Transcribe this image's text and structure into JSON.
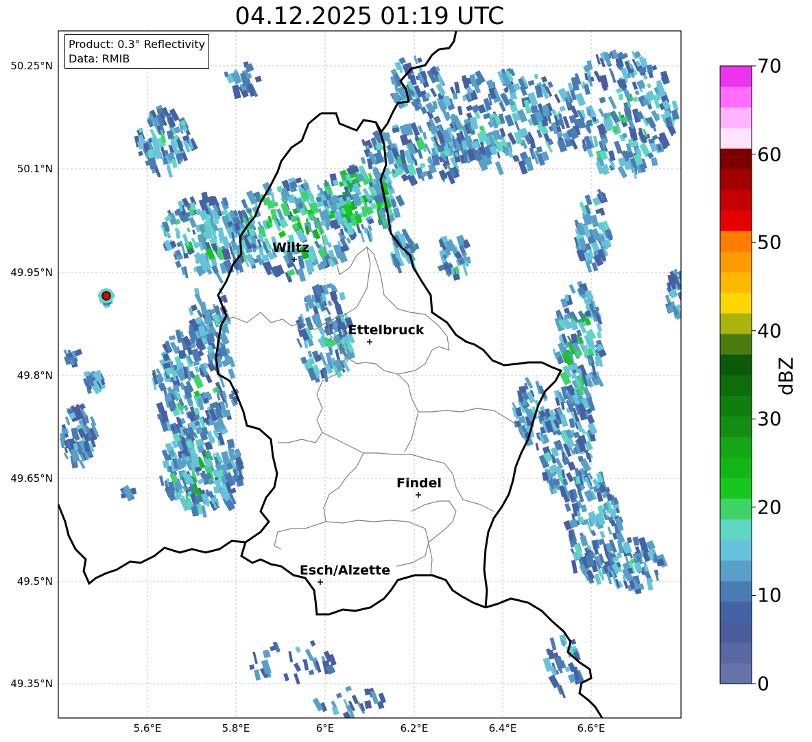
{
  "title": "04.12.2025 01:19 UTC",
  "info": {
    "product": "Product: 0.3° Reflectivity",
    "source": "Data: RMIB"
  },
  "lat_labels": [
    "50.25°N",
    "50.1°N",
    "49.95°N",
    "49.8°N",
    "49.65°N",
    "49.5°N",
    "49.35°N"
  ],
  "lon_labels": [
    "5.6°E",
    "5.8°E",
    "6°E",
    "6.2°E",
    "6.4°E",
    "6.6°E"
  ],
  "cities": [
    {
      "name": "Wiltz"
    },
    {
      "name": "Ettelbruck"
    },
    {
      "name": "Findel"
    },
    {
      "name": "Esch/Alzette"
    }
  ],
  "colorbar": {
    "unit": "dBZ",
    "ticks": [
      "70",
      "60",
      "50",
      "40",
      "30",
      "20",
      "10",
      "0"
    ],
    "min": 0,
    "max": 70,
    "step": 2.5,
    "colors": [
      "#6673a8",
      "#5968a2",
      "#4c5d9e",
      "#4462a6",
      "#4a7cb4",
      "#58a0c8",
      "#67c3db",
      "#5ed7c3",
      "#3dd567",
      "#16c81e",
      "#12b616",
      "#14a614",
      "#138d13",
      "#0f7e0f",
      "#0b6e0b",
      "#0a5a0a",
      "#4b7c10",
      "#aab40a",
      "#ffd700",
      "#ffb800",
      "#ff9a00",
      "#ff7d00",
      "#e50000",
      "#c40000",
      "#a20000",
      "#7d0000",
      "#ffe3ff",
      "#ffb4ff",
      "#ff6cff",
      "#ee33ee"
    ]
  },
  "map": {
    "extent": {
      "lon_min": 5.4,
      "lon_max": 6.8,
      "lat_min": 49.3,
      "lat_max": 50.3
    },
    "gridlines": true,
    "colors": {
      "country_border": "#000000",
      "canton_border": "#808080",
      "grid": "#b5b5b5"
    },
    "radar_site": {
      "marker": "red-circle"
    }
  }
}
